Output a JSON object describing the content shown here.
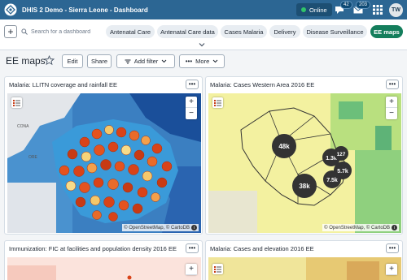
{
  "header": {
    "title": "DHIS 2 Demo - Sierra Leone - Dashboard",
    "online": "Online",
    "messages_count": "42",
    "interpretations_count": "203",
    "avatar": "TW",
    "colors": {
      "bar": "#2c6693",
      "online_dot": "#30c46a"
    }
  },
  "dashbar": {
    "search_placeholder": "Search for a dashboard",
    "dashboards": [
      {
        "label": "Antenatal Care",
        "active": false
      },
      {
        "label": "Antenatal Care data",
        "active": false
      },
      {
        "label": "Cases Malaria",
        "active": false
      },
      {
        "label": "Delivery",
        "active": false
      },
      {
        "label": "Disease Surveillance",
        "active": false
      },
      {
        "label": "EE maps",
        "active": true
      }
    ],
    "active_color": "#147e5c"
  },
  "dashboard": {
    "title": "EE maps",
    "edit_label": "Edit",
    "share_label": "Share",
    "add_filter_label": "Add filter",
    "more_label": "More"
  },
  "items": [
    {
      "title": "Malaria: LLITN coverage and rainfall EE",
      "attribution": "© OpenStreetMap, © CartoDB",
      "map_labels": [
        "CONA",
        "ORE"
      ]
    },
    {
      "title": "Malaria: Cases Western Area 2016 EE",
      "attribution": "© OpenStreetMap, © CartoDB",
      "clusters": [
        "48k",
        "1.3k",
        "127",
        "5.7k",
        "7.5k",
        "38k"
      ]
    },
    {
      "title": "Immunization: FIC at facilities and population density 2016 EE"
    },
    {
      "title": "Malaria: Cases and elevation 2016 EE"
    }
  ]
}
